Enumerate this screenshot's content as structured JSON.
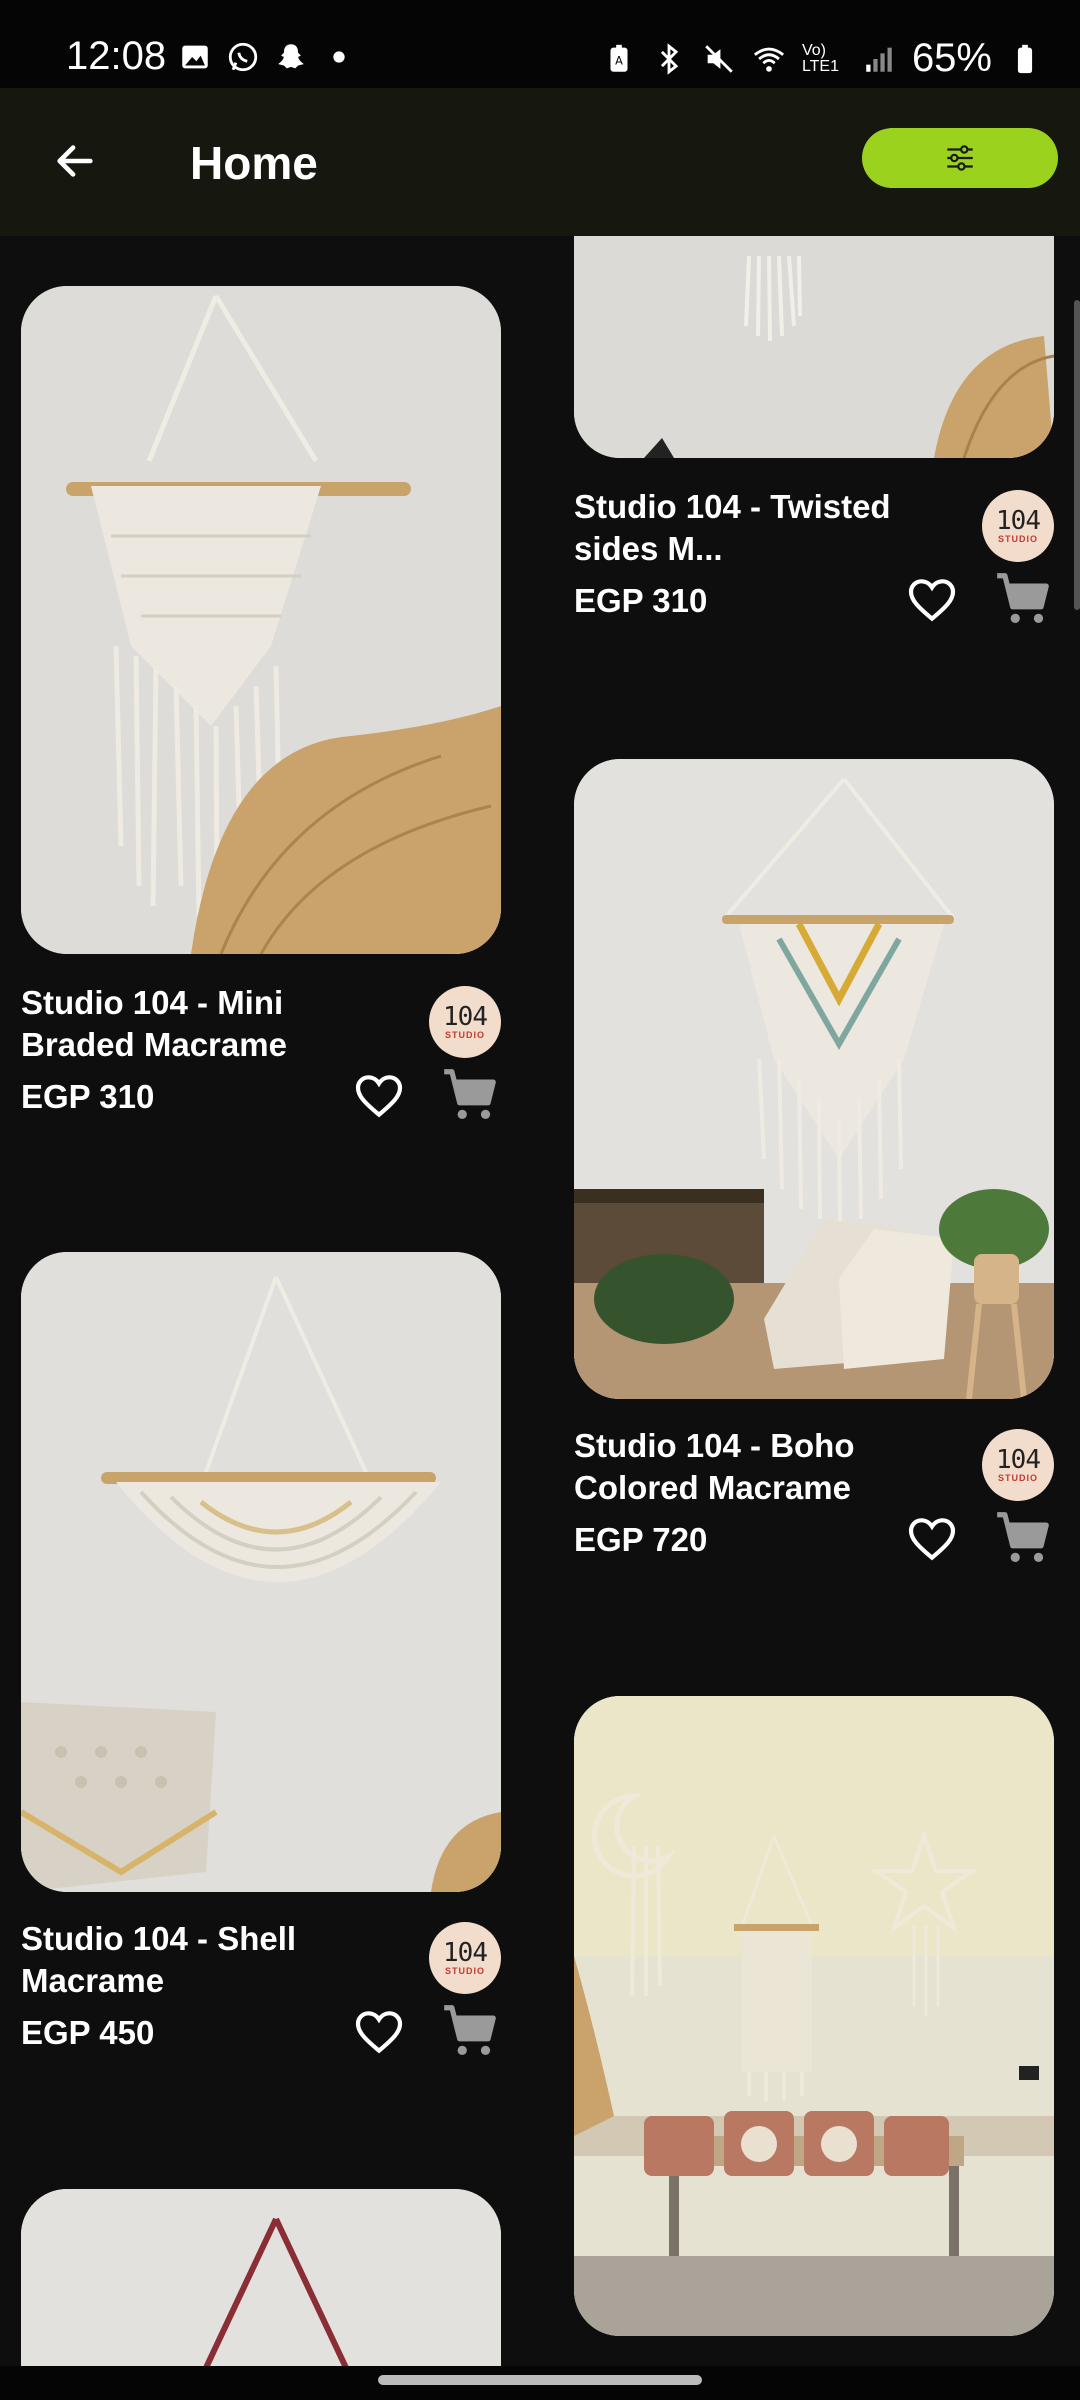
{
  "status_bar": {
    "time": "12:08",
    "battery": "65%",
    "network": "Vo) LTE1"
  },
  "header": {
    "title": "Home",
    "filter_color": "#9bd21e"
  },
  "products": [
    {
      "title": "Studio 104 - Mini Braded Macrame",
      "price": "EGP 310"
    },
    {
      "title": "Studio 104 - Twisted sides M...",
      "price": "EGP 310"
    },
    {
      "title": "Studio 104 - Boho Colored Macrame",
      "price": "EGP 720"
    },
    {
      "title": "Studio 104 - Shell Macrame",
      "price": "EGP 450"
    }
  ],
  "store_logo": {
    "big": "104",
    "small": "STUDIO"
  },
  "icons": [
    "back-arrow-icon",
    "filter-sliders-icon",
    "heart-icon",
    "cart-icon"
  ]
}
